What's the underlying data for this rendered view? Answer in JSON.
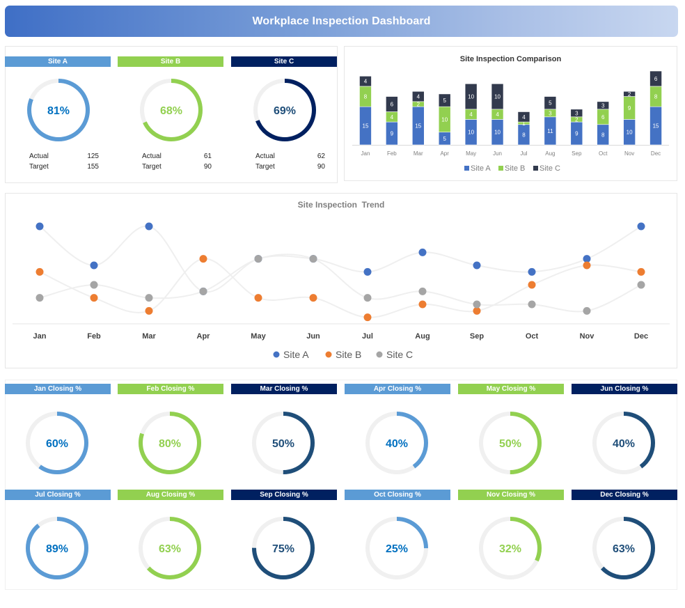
{
  "header": {
    "title": "Workplace Inspection Dashboard"
  },
  "colors": {
    "site_a": "#5b9bd5",
    "site_b": "#92d050",
    "site_c": "#002060",
    "bar_a": "#4472c4",
    "bar_b": "#92d050",
    "bar_c": "#323a4d",
    "trend_a": "#4472c4",
    "trend_b": "#ed7d31",
    "trend_c": "#a5a5a5",
    "track": "#f0f0f0"
  },
  "sites": [
    {
      "name": "Site A",
      "percent": 81,
      "percent_label": "81%",
      "actual_label": "Actual",
      "actual": "125",
      "target_label": "Target",
      "target": "155",
      "color": "#5b9bd5",
      "text_color": "#0070c0"
    },
    {
      "name": "Site B",
      "percent": 68,
      "percent_label": "68%",
      "actual_label": "Actual",
      "actual": "61",
      "target_label": "Target",
      "target": "90",
      "color": "#92d050",
      "text_color": "#92d050"
    },
    {
      "name": "Site C",
      "percent": 69,
      "percent_label": "69%",
      "actual_label": "Actual",
      "actual": "62",
      "target_label": "Target",
      "target": "90",
      "color": "#002060",
      "text_color": "#1f4e79"
    }
  ],
  "closing": [
    {
      "label": "Jan Closing %",
      "percent": 60,
      "percent_label": "60%",
      "hdr": "#5b9bd5",
      "ring": "#5b9bd5",
      "text": "#0070c0"
    },
    {
      "label": "Feb Closing %",
      "percent": 80,
      "percent_label": "80%",
      "hdr": "#92d050",
      "ring": "#92d050",
      "text": "#92d050"
    },
    {
      "label": "Mar Closing %",
      "percent": 50,
      "percent_label": "50%",
      "hdr": "#002060",
      "ring": "#1f4e79",
      "text": "#1f4e79"
    },
    {
      "label": "Apr Closing %",
      "percent": 40,
      "percent_label": "40%",
      "hdr": "#5b9bd5",
      "ring": "#5b9bd5",
      "text": "#0070c0"
    },
    {
      "label": "May Closing %",
      "percent": 50,
      "percent_label": "50%",
      "hdr": "#92d050",
      "ring": "#92d050",
      "text": "#92d050"
    },
    {
      "label": "Jun Closing %",
      "percent": 40,
      "percent_label": "40%",
      "hdr": "#002060",
      "ring": "#1f4e79",
      "text": "#1f4e79"
    },
    {
      "label": "Jul Closing %",
      "percent": 89,
      "percent_label": "89%",
      "hdr": "#5b9bd5",
      "ring": "#5b9bd5",
      "text": "#0070c0"
    },
    {
      "label": "Aug Closing %",
      "percent": 63,
      "percent_label": "63%",
      "hdr": "#92d050",
      "ring": "#92d050",
      "text": "#92d050"
    },
    {
      "label": "Sep Closing %",
      "percent": 75,
      "percent_label": "75%",
      "hdr": "#002060",
      "ring": "#1f4e79",
      "text": "#1f4e79"
    },
    {
      "label": "Oct Closing %",
      "percent": 25,
      "percent_label": "25%",
      "hdr": "#5b9bd5",
      "ring": "#5b9bd5",
      "text": "#0070c0"
    },
    {
      "label": "Nov Closing %",
      "percent": 32,
      "percent_label": "32%",
      "hdr": "#92d050",
      "ring": "#92d050",
      "text": "#92d050"
    },
    {
      "label": "Dec Closing %",
      "percent": 63,
      "percent_label": "63%",
      "hdr": "#002060",
      "ring": "#1f4e79",
      "text": "#1f4e79"
    }
  ],
  "chart_data": [
    {
      "type": "bar",
      "stacked": true,
      "title": "Site Inspection Comparison",
      "categories": [
        "Jan",
        "Feb",
        "Mar",
        "Apr",
        "May",
        "Jun",
        "Jul",
        "Aug",
        "Sep",
        "Oct",
        "Nov",
        "Dec"
      ],
      "series": [
        {
          "name": "Site A",
          "values": [
            15,
            9,
            15,
            5,
            10,
            10,
            8,
            11,
            9,
            8,
            10,
            15
          ]
        },
        {
          "name": "Site B",
          "values": [
            8,
            4,
            2,
            10,
            4,
            4,
            1,
            3,
            2,
            6,
            9,
            8
          ]
        },
        {
          "name": "Site C",
          "values": [
            4,
            6,
            4,
            5,
            10,
            10,
            4,
            5,
            3,
            3,
            2,
            6
          ]
        }
      ],
      "data_labels": true,
      "legend": "bottom",
      "grid": false
    },
    {
      "type": "line",
      "smooth": true,
      "title": "Site Inspection  Trend",
      "categories": [
        "Jan",
        "Feb",
        "Mar",
        "Apr",
        "May",
        "Jun",
        "Jul",
        "Aug",
        "Sep",
        "Oct",
        "Nov",
        "Dec"
      ],
      "series": [
        {
          "name": "Site A",
          "values": [
            15,
            9,
            15,
            5,
            10,
            10,
            8,
            11,
            9,
            8,
            10,
            15
          ]
        },
        {
          "name": "Site B",
          "values": [
            8,
            4,
            2,
            10,
            4,
            4,
            1,
            3,
            2,
            6,
            9,
            8
          ]
        },
        {
          "name": "Site C",
          "values": [
            4,
            6,
            4,
            5,
            10,
            10,
            4,
            5,
            3,
            3,
            2,
            6
          ]
        }
      ],
      "ylim": [
        0,
        16
      ],
      "legend": "bottom",
      "grid": false
    }
  ]
}
